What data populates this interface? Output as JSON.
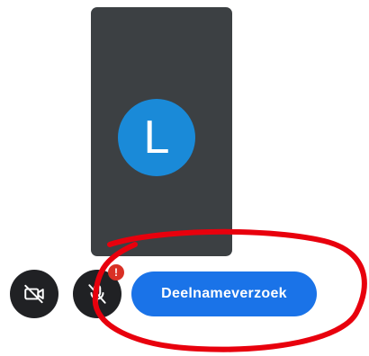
{
  "preview": {
    "avatar_initial": "L"
  },
  "controls": {
    "camera_icon": "camera-off-icon",
    "mic_icon": "mic-off-icon",
    "mic_alert_badge": "!",
    "join_request_label": "Deelnameverzoek"
  },
  "colors": {
    "tile_background": "#3c4043",
    "avatar_background": "#1a8ad8",
    "control_button": "#202124",
    "alert_badge": "#d93025",
    "primary_button": "#1a73e8",
    "annotation_circle": "#e8000d"
  }
}
